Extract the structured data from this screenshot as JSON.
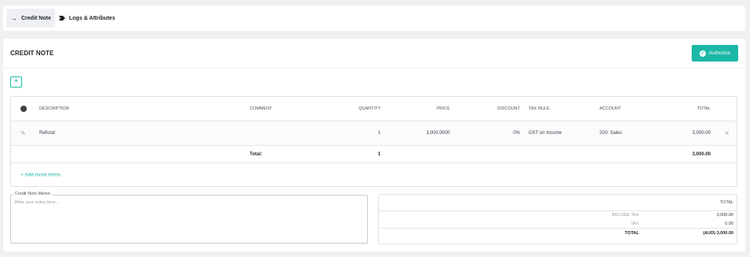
{
  "tabs": [
    {
      "label": "Credit Note",
      "icon": "arrow-right-icon",
      "active": true
    },
    {
      "label": "Logs & Attributes",
      "icon": "tag-icon",
      "active": false
    }
  ],
  "card": {
    "title": "CREDIT NOTE",
    "authorise_label": "Authorise",
    "accent_color": "#1bb8a6"
  },
  "table": {
    "columns": {
      "description": "DESCRIPTION",
      "comment": "COMMENT",
      "quantity": "QUANTITY",
      "price": "PRICE",
      "discount": "DISCOUNT",
      "tax_rule": "TAX RULE",
      "account": "ACCOUNT",
      "total": "TOTAL"
    },
    "rows": [
      {
        "description": "Refund:",
        "comment": "",
        "quantity": "1",
        "price": "3,000.0000",
        "discount": "0%",
        "tax_rule": "GST on Income",
        "account": "200: Sales",
        "total": "3,000.00"
      }
    ],
    "totals_row": {
      "label": "Total:",
      "quantity": "1",
      "total": "3,000.00"
    },
    "add_more_label": "+ Add more items"
  },
  "memo": {
    "label": "Credit Note Memo",
    "placeholder": "Write your notes here..."
  },
  "summary": {
    "header": "TOTAL",
    "before_tax_label": "BEFORE TAX",
    "before_tax_value": "3,000.00",
    "tax_label": "TAX",
    "tax_value": "0.00",
    "total_label": "TOTAL",
    "total_value": "(AUD) 3,000.00"
  }
}
